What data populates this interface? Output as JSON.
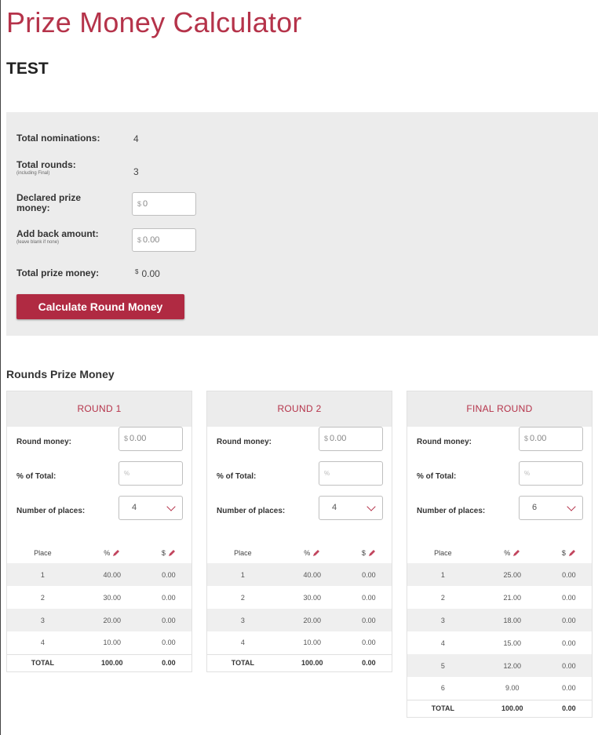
{
  "title": "Prize Money Calculator",
  "event_name": "TEST",
  "summary": {
    "total_nominations_label": "Total nominations:",
    "total_nominations_value": "4",
    "total_rounds_label": "Total rounds:",
    "total_rounds_sub": "(including Final)",
    "total_rounds_value": "3",
    "declared_label": "Declared prize money:",
    "declared_currency": "$",
    "declared_value": "0",
    "addback_label": "Add back amount:",
    "addback_sub": "(leave blank if none)",
    "addback_currency": "$",
    "addback_value": "0.00",
    "total_prize_label": "Total prize money:",
    "total_prize_currency": "$",
    "total_prize_value": "0.00",
    "calculate_button": "Calculate Round Money"
  },
  "rounds_heading": "Rounds Prize Money",
  "labels": {
    "round_money": "Round money:",
    "pct_total": "% of Total:",
    "num_places": "Number of places:",
    "col_place": "Place",
    "col_pct": "%",
    "col_dollar": "$",
    "currency": "$",
    "pct_placeholder": "%",
    "total_label": "TOTAL"
  },
  "rounds": [
    {
      "name": "ROUND 1",
      "round_money": "0.00",
      "num_places": "4",
      "rows": [
        {
          "place": "1",
          "pct": "40.00",
          "amount": "0.00"
        },
        {
          "place": "2",
          "pct": "30.00",
          "amount": "0.00"
        },
        {
          "place": "3",
          "pct": "20.00",
          "amount": "0.00"
        },
        {
          "place": "4",
          "pct": "10.00",
          "amount": "0.00"
        }
      ],
      "total_pct": "100.00",
      "total_amount": "0.00"
    },
    {
      "name": "ROUND 2",
      "round_money": "0.00",
      "num_places": "4",
      "rows": [
        {
          "place": "1",
          "pct": "40.00",
          "amount": "0.00"
        },
        {
          "place": "2",
          "pct": "30.00",
          "amount": "0.00"
        },
        {
          "place": "3",
          "pct": "20.00",
          "amount": "0.00"
        },
        {
          "place": "4",
          "pct": "10.00",
          "amount": "0.00"
        }
      ],
      "total_pct": "100.00",
      "total_amount": "0.00"
    },
    {
      "name": "FINAL ROUND",
      "round_money": "0.00",
      "num_places": "6",
      "rows": [
        {
          "place": "1",
          "pct": "25.00",
          "amount": "0.00"
        },
        {
          "place": "2",
          "pct": "21.00",
          "amount": "0.00"
        },
        {
          "place": "3",
          "pct": "18.00",
          "amount": "0.00"
        },
        {
          "place": "4",
          "pct": "15.00",
          "amount": "0.00"
        },
        {
          "place": "5",
          "pct": "12.00",
          "amount": "0.00"
        },
        {
          "place": "6",
          "pct": "9.00",
          "amount": "0.00"
        }
      ],
      "total_pct": "100.00",
      "total_amount": "0.00"
    }
  ],
  "colors": {
    "accent": "#b5334a",
    "button": "#b02a42",
    "panel": "#ececec"
  }
}
